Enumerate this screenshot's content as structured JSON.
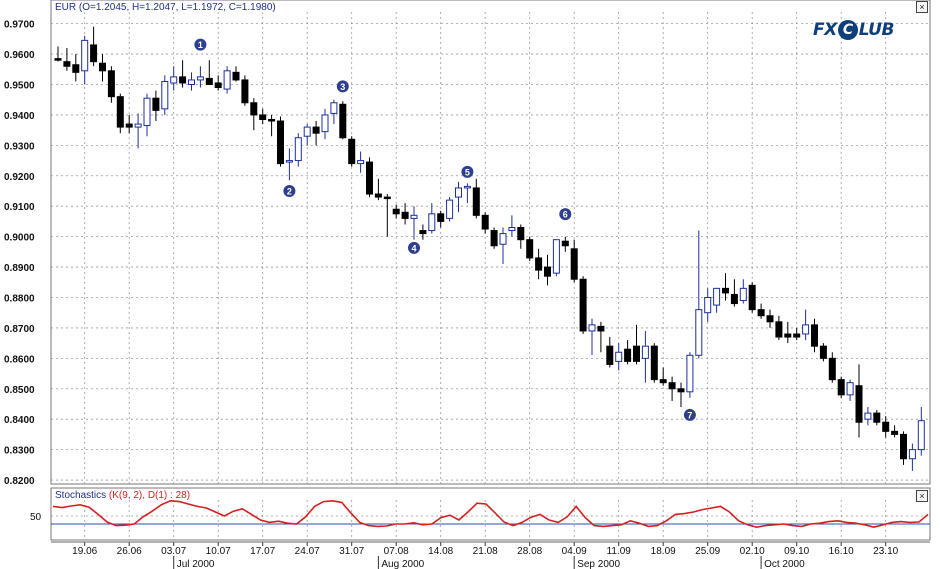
{
  "main_title": {
    "symbol": "EUR",
    "ohlc": "(O=1.2045, H=1.2047, L=1.1972, C=1.1980)"
  },
  "logo": {
    "part1": "FX",
    "glyph": "C",
    "part2": "LUB"
  },
  "stoch_title": {
    "name": "Stochastics",
    "params": "(K(9, 2), D(1) : 28)"
  },
  "close_glyph": "×",
  "colors": {
    "bull_fill": "#ffffff",
    "bull_border": "#1c2f9e",
    "bear_fill": "#000000",
    "grid": "#9a9a9a",
    "stoch_line": "#d62020",
    "stoch_level": "#2a4fb0",
    "marker_fill": "#2e3f8f"
  },
  "chart_data": [
    {
      "type": "candlestick",
      "y_axis_labels": [
        "0.9700",
        "0.9600",
        "0.9500",
        "0.9400",
        "0.9300",
        "0.9200",
        "0.9100",
        "0.9000",
        "0.8900",
        "0.8800",
        "0.8700",
        "0.8600",
        "0.8500",
        "0.8400",
        "0.8300",
        "0.8200"
      ],
      "ylim": [
        0.8187,
        0.9735
      ],
      "x_tick_labels": [
        "19.06",
        "26.06",
        "03.07",
        "10.07",
        "17.07",
        "24.07",
        "31.07",
        "07.08",
        "14.08",
        "21.08",
        "28.08",
        "04.09",
        "11.09",
        "18.09",
        "25.09",
        "02.10",
        "09.10",
        "16.10",
        "23.10"
      ],
      "month_labels": [
        "Jul 2000",
        "Aug 2000",
        "Sep 2000",
        "Oct 2000"
      ],
      "candles": [
        {
          "o": 0.9585,
          "h": 0.9625,
          "l": 0.9575,
          "c": 0.958
        },
        {
          "o": 0.9575,
          "h": 0.962,
          "l": 0.9545,
          "c": 0.956
        },
        {
          "o": 0.9565,
          "h": 0.96,
          "l": 0.951,
          "c": 0.954
        },
        {
          "o": 0.9545,
          "h": 0.966,
          "l": 0.95,
          "c": 0.9645
        },
        {
          "o": 0.963,
          "h": 0.969,
          "l": 0.956,
          "c": 0.9575
        },
        {
          "o": 0.957,
          "h": 0.96,
          "l": 0.951,
          "c": 0.9545
        },
        {
          "o": 0.9545,
          "h": 0.956,
          "l": 0.944,
          "c": 0.946
        },
        {
          "o": 0.946,
          "h": 0.947,
          "l": 0.934,
          "c": 0.936
        },
        {
          "o": 0.937,
          "h": 0.94,
          "l": 0.934,
          "c": 0.936
        },
        {
          "o": 0.936,
          "h": 0.9405,
          "l": 0.929,
          "c": 0.937
        },
        {
          "o": 0.9365,
          "h": 0.947,
          "l": 0.933,
          "c": 0.9455
        },
        {
          "o": 0.9455,
          "h": 0.948,
          "l": 0.938,
          "c": 0.9415
        },
        {
          "o": 0.942,
          "h": 0.953,
          "l": 0.94,
          "c": 0.951
        },
        {
          "o": 0.9505,
          "h": 0.956,
          "l": 0.948,
          "c": 0.9525
        },
        {
          "o": 0.9525,
          "h": 0.958,
          "l": 0.949,
          "c": 0.9505
        },
        {
          "o": 0.95,
          "h": 0.954,
          "l": 0.948,
          "c": 0.9515
        },
        {
          "o": 0.9515,
          "h": 0.956,
          "l": 0.949,
          "c": 0.9525
        },
        {
          "o": 0.952,
          "h": 0.958,
          "l": 0.95,
          "c": 0.95
        },
        {
          "o": 0.9505,
          "h": 0.953,
          "l": 0.948,
          "c": 0.949
        },
        {
          "o": 0.9485,
          "h": 0.956,
          "l": 0.947,
          "c": 0.9545
        },
        {
          "o": 0.954,
          "h": 0.956,
          "l": 0.951,
          "c": 0.9515
        },
        {
          "o": 0.9515,
          "h": 0.953,
          "l": 0.943,
          "c": 0.944
        },
        {
          "o": 0.944,
          "h": 0.9455,
          "l": 0.935,
          "c": 0.94
        },
        {
          "o": 0.94,
          "h": 0.942,
          "l": 0.937,
          "c": 0.9385
        },
        {
          "o": 0.9385,
          "h": 0.94,
          "l": 0.933,
          "c": 0.938
        },
        {
          "o": 0.938,
          "h": 0.9395,
          "l": 0.923,
          "c": 0.924
        },
        {
          "o": 0.9245,
          "h": 0.929,
          "l": 0.9185,
          "c": 0.925
        },
        {
          "o": 0.925,
          "h": 0.934,
          "l": 0.923,
          "c": 0.9325
        },
        {
          "o": 0.933,
          "h": 0.937,
          "l": 0.93,
          "c": 0.936
        },
        {
          "o": 0.936,
          "h": 0.938,
          "l": 0.93,
          "c": 0.934
        },
        {
          "o": 0.9345,
          "h": 0.942,
          "l": 0.932,
          "c": 0.94
        },
        {
          "o": 0.9405,
          "h": 0.945,
          "l": 0.937,
          "c": 0.944
        },
        {
          "o": 0.9435,
          "h": 0.9445,
          "l": 0.932,
          "c": 0.9325
        },
        {
          "o": 0.932,
          "h": 0.933,
          "l": 0.923,
          "c": 0.924
        },
        {
          "o": 0.924,
          "h": 0.928,
          "l": 0.921,
          "c": 0.925
        },
        {
          "o": 0.9245,
          "h": 0.926,
          "l": 0.913,
          "c": 0.914
        },
        {
          "o": 0.914,
          "h": 0.919,
          "l": 0.912,
          "c": 0.913
        },
        {
          "o": 0.913,
          "h": 0.914,
          "l": 0.9,
          "c": 0.9125
        },
        {
          "o": 0.909,
          "h": 0.9105,
          "l": 0.906,
          "c": 0.9075
        },
        {
          "o": 0.908,
          "h": 0.911,
          "l": 0.904,
          "c": 0.906
        },
        {
          "o": 0.906,
          "h": 0.91,
          "l": 0.899,
          "c": 0.907
        },
        {
          "o": 0.902,
          "h": 0.904,
          "l": 0.899,
          "c": 0.901
        },
        {
          "o": 0.902,
          "h": 0.911,
          "l": 0.901,
          "c": 0.9075
        },
        {
          "o": 0.9075,
          "h": 0.9085,
          "l": 0.903,
          "c": 0.905
        },
        {
          "o": 0.906,
          "h": 0.913,
          "l": 0.905,
          "c": 0.912
        },
        {
          "o": 0.913,
          "h": 0.918,
          "l": 0.908,
          "c": 0.916
        },
        {
          "o": 0.916,
          "h": 0.9175,
          "l": 0.911,
          "c": 0.9165
        },
        {
          "o": 0.916,
          "h": 0.919,
          "l": 0.906,
          "c": 0.907
        },
        {
          "o": 0.907,
          "h": 0.908,
          "l": 0.901,
          "c": 0.9025
        },
        {
          "o": 0.902,
          "h": 0.903,
          "l": 0.896,
          "c": 0.897
        },
        {
          "o": 0.8975,
          "h": 0.903,
          "l": 0.891,
          "c": 0.901
        },
        {
          "o": 0.902,
          "h": 0.907,
          "l": 0.9,
          "c": 0.903
        },
        {
          "o": 0.903,
          "h": 0.904,
          "l": 0.896,
          "c": 0.899
        },
        {
          "o": 0.899,
          "h": 0.9,
          "l": 0.892,
          "c": 0.893
        },
        {
          "o": 0.893,
          "h": 0.896,
          "l": 0.886,
          "c": 0.889
        },
        {
          "o": 0.89,
          "h": 0.894,
          "l": 0.884,
          "c": 0.887
        },
        {
          "o": 0.888,
          "h": 0.899,
          "l": 0.887,
          "c": 0.899
        },
        {
          "o": 0.8985,
          "h": 0.9,
          "l": 0.895,
          "c": 0.897
        },
        {
          "o": 0.896,
          "h": 0.899,
          "l": 0.885,
          "c": 0.886
        },
        {
          "o": 0.886,
          "h": 0.887,
          "l": 0.868,
          "c": 0.869
        },
        {
          "o": 0.869,
          "h": 0.873,
          "l": 0.861,
          "c": 0.871
        },
        {
          "o": 0.8705,
          "h": 0.872,
          "l": 0.862,
          "c": 0.869
        },
        {
          "o": 0.864,
          "h": 0.867,
          "l": 0.857,
          "c": 0.858
        },
        {
          "o": 0.859,
          "h": 0.865,
          "l": 0.856,
          "c": 0.862
        },
        {
          "o": 0.863,
          "h": 0.866,
          "l": 0.858,
          "c": 0.859
        },
        {
          "o": 0.864,
          "h": 0.871,
          "l": 0.858,
          "c": 0.859
        },
        {
          "o": 0.86,
          "h": 0.869,
          "l": 0.852,
          "c": 0.864
        },
        {
          "o": 0.864,
          "h": 0.865,
          "l": 0.852,
          "c": 0.853
        },
        {
          "o": 0.853,
          "h": 0.857,
          "l": 0.851,
          "c": 0.852
        },
        {
          "o": 0.852,
          "h": 0.854,
          "l": 0.846,
          "c": 0.85
        },
        {
          "o": 0.85,
          "h": 0.852,
          "l": 0.844,
          "c": 0.849
        },
        {
          "o": 0.849,
          "h": 0.862,
          "l": 0.847,
          "c": 0.861
        },
        {
          "o": 0.861,
          "h": 0.902,
          "l": 0.86,
          "c": 0.876
        },
        {
          "o": 0.875,
          "h": 0.883,
          "l": 0.872,
          "c": 0.88
        },
        {
          "o": 0.8775,
          "h": 0.883,
          "l": 0.875,
          "c": 0.883
        },
        {
          "o": 0.883,
          "h": 0.888,
          "l": 0.879,
          "c": 0.8815
        },
        {
          "o": 0.881,
          "h": 0.886,
          "l": 0.877,
          "c": 0.878
        },
        {
          "o": 0.879,
          "h": 0.886,
          "l": 0.878,
          "c": 0.883
        },
        {
          "o": 0.884,
          "h": 0.885,
          "l": 0.875,
          "c": 0.876
        },
        {
          "o": 0.876,
          "h": 0.878,
          "l": 0.873,
          "c": 0.874
        },
        {
          "o": 0.874,
          "h": 0.876,
          "l": 0.87,
          "c": 0.872
        },
        {
          "o": 0.872,
          "h": 0.874,
          "l": 0.866,
          "c": 0.867
        },
        {
          "o": 0.868,
          "h": 0.872,
          "l": 0.865,
          "c": 0.867
        },
        {
          "o": 0.868,
          "h": 0.87,
          "l": 0.866,
          "c": 0.867
        },
        {
          "o": 0.868,
          "h": 0.876,
          "l": 0.866,
          "c": 0.871
        },
        {
          "o": 0.871,
          "h": 0.873,
          "l": 0.862,
          "c": 0.864
        },
        {
          "o": 0.864,
          "h": 0.865,
          "l": 0.859,
          "c": 0.86
        },
        {
          "o": 0.86,
          "h": 0.862,
          "l": 0.852,
          "c": 0.853
        },
        {
          "o": 0.853,
          "h": 0.854,
          "l": 0.847,
          "c": 0.848
        },
        {
          "o": 0.848,
          "h": 0.853,
          "l": 0.846,
          "c": 0.852
        },
        {
          "o": 0.851,
          "h": 0.858,
          "l": 0.834,
          "c": 0.839
        },
        {
          "o": 0.84,
          "h": 0.844,
          "l": 0.838,
          "c": 0.842
        },
        {
          "o": 0.842,
          "h": 0.843,
          "l": 0.838,
          "c": 0.839
        },
        {
          "o": 0.839,
          "h": 0.841,
          "l": 0.834,
          "c": 0.836
        },
        {
          "o": 0.836,
          "h": 0.838,
          "l": 0.834,
          "c": 0.835
        },
        {
          "o": 0.835,
          "h": 0.836,
          "l": 0.825,
          "c": 0.827
        },
        {
          "o": 0.827,
          "h": 0.832,
          "l": 0.823,
          "c": 0.83
        },
        {
          "o": 0.83,
          "h": 0.844,
          "l": 0.828,
          "c": 0.8395
        }
      ],
      "markers": [
        {
          "label": "1",
          "index": 16,
          "price": 0.9631
        },
        {
          "label": "2",
          "index": 26,
          "price": 0.915
        },
        {
          "label": "3",
          "index": 32,
          "price": 0.9494
        },
        {
          "label": "4",
          "index": 40,
          "price": 0.8963
        },
        {
          "label": "5",
          "index": 46,
          "price": 0.9213
        },
        {
          "label": "6",
          "index": 57,
          "price": 0.9074
        },
        {
          "label": "7",
          "index": 71,
          "price": 0.8414
        }
      ]
    },
    {
      "type": "line",
      "name": "Stochastics",
      "y_axis_labels": [
        "50"
      ],
      "level": 30,
      "ylim": [
        -10,
        110
      ],
      "values": [
        74,
        71,
        75,
        78,
        72,
        54,
        35,
        26,
        27,
        30,
        48,
        62,
        78,
        88,
        86,
        80,
        74,
        70,
        60,
        50,
        62,
        68,
        54,
        40,
        34,
        37,
        32,
        30,
        48,
        74,
        86,
        88,
        84,
        58,
        34,
        26,
        24,
        25,
        30,
        30,
        33,
        28,
        30,
        46,
        52,
        40,
        60,
        82,
        80,
        58,
        35,
        26,
        34,
        47,
        54,
        40,
        34,
        48,
        74,
        46,
        26,
        24,
        26,
        28,
        38,
        32,
        24,
        26,
        38,
        54,
        56,
        60,
        66,
        70,
        74,
        60,
        38,
        28,
        22,
        26,
        28,
        30,
        26,
        24,
        30,
        32,
        36,
        38,
        34,
        32,
        28,
        22,
        28,
        34,
        36,
        34,
        35,
        54
      ]
    }
  ]
}
